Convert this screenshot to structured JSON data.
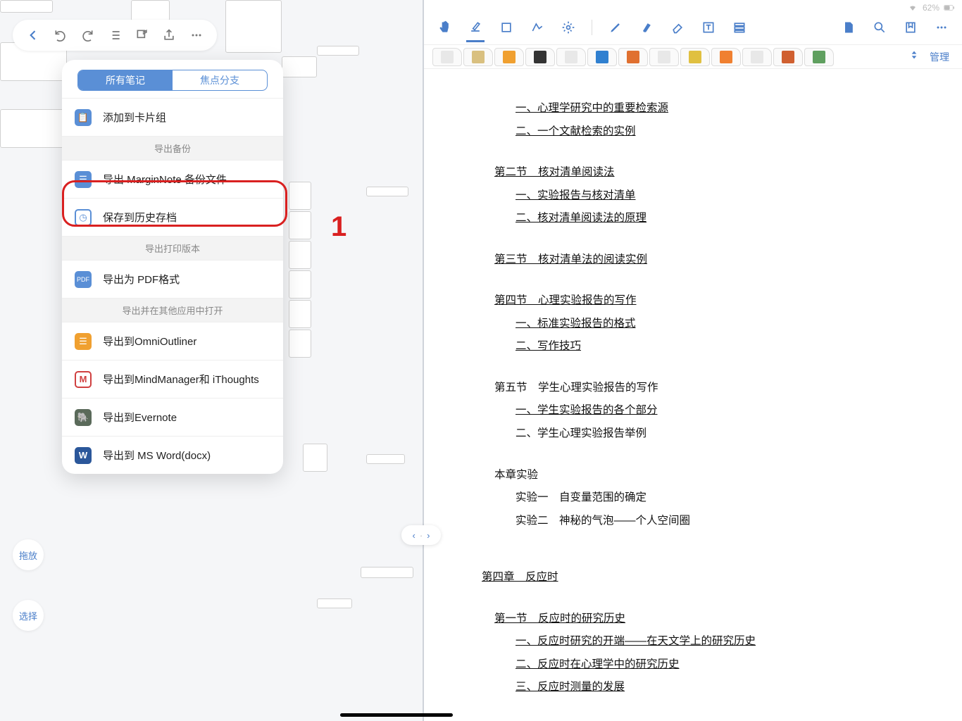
{
  "status": {
    "battery": "62%"
  },
  "left_buttons": {
    "drag": "拖放",
    "select": "选择"
  },
  "popover": {
    "seg_on": "所有笔记",
    "seg_off": "焦点分支",
    "add_card": "添加到卡片组",
    "section_backup": "导出备份",
    "export_mn": "导出 MarginNote 备份文件",
    "save_history": "保存到历史存档",
    "section_print": "导出打印版本",
    "export_pdf": "导出为 PDF格式",
    "section_open": "导出并在其他应用中打开",
    "export_oo": "导出到OmniOutliner",
    "export_mm": "导出到MindManager和 iThoughts",
    "export_ev": "导出到Evernote",
    "export_word": "导出到 MS Word(docx)"
  },
  "annot": {
    "one": "1"
  },
  "tab_manage": "管理",
  "doc": {
    "c1": "一、心理学研究中的重要检索源",
    "c2": "二、一个文献检索的实例",
    "c3": "第二节　核对清单阅读法",
    "c4": "一、实验报告与核对清单",
    "c5": "二、核对清单阅读法的原理",
    "c6": "第三节　核对清单法的阅读实例",
    "c7": "第四节　心理实验报告的写作",
    "c8": "一、标准实验报告的格式",
    "c9": "二、写作技巧",
    "c10": "第五节　学生心理实验报告的写作",
    "c11": "一、学生实验报告的各个部分",
    "c12": "二、学生心理实验报告举例",
    "c13": "本章实验",
    "c14": "实验一　自变量范围的确定",
    "c15": "实验二　神秘的气泡——个人空间圈",
    "c16": "第四章　反应时",
    "c17": "第一节　反应时的研究历史",
    "c18": "一、反应时研究的开端——在天文学上的研究历史",
    "c19": "二、反应时在心理学中的研究历史",
    "c20": "三、反应时测量的发展"
  },
  "tab_colors": [
    "#e8e8e8",
    "#d9c080",
    "#f0a030",
    "#333",
    "#e8e8e8",
    "#3080d0",
    "#e07030",
    "#e8e8e8",
    "#e0c040",
    "#f08030",
    "#e8e8e8",
    "#d06030",
    "#60a060"
  ]
}
